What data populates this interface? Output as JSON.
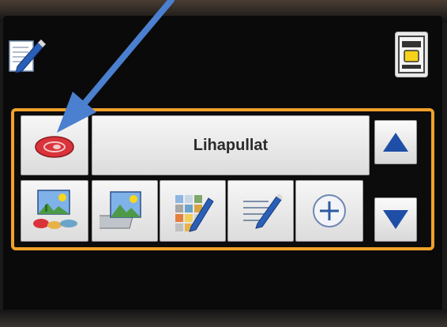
{
  "program": {
    "name": "Lihapullat"
  },
  "icons": {
    "top_left": "edit-pencil-icon",
    "top_right": "menu-panel-icon",
    "program_category": "red-meat-icon",
    "action_1": "landscape-food-icon",
    "action_2": "photo-album-icon",
    "action_3": "color-grid-edit-icon",
    "action_4": "text-edit-icon",
    "action_5": "add-circle-icon",
    "scroll_up": "up-arrow-icon",
    "scroll_down": "down-arrow-icon"
  },
  "colors": {
    "panel_border": "#f1a12a",
    "scroll_arrow": "#1f4ea6",
    "pointer_arrow": "#4b7fcf",
    "meat_icon": "#d9333b"
  }
}
